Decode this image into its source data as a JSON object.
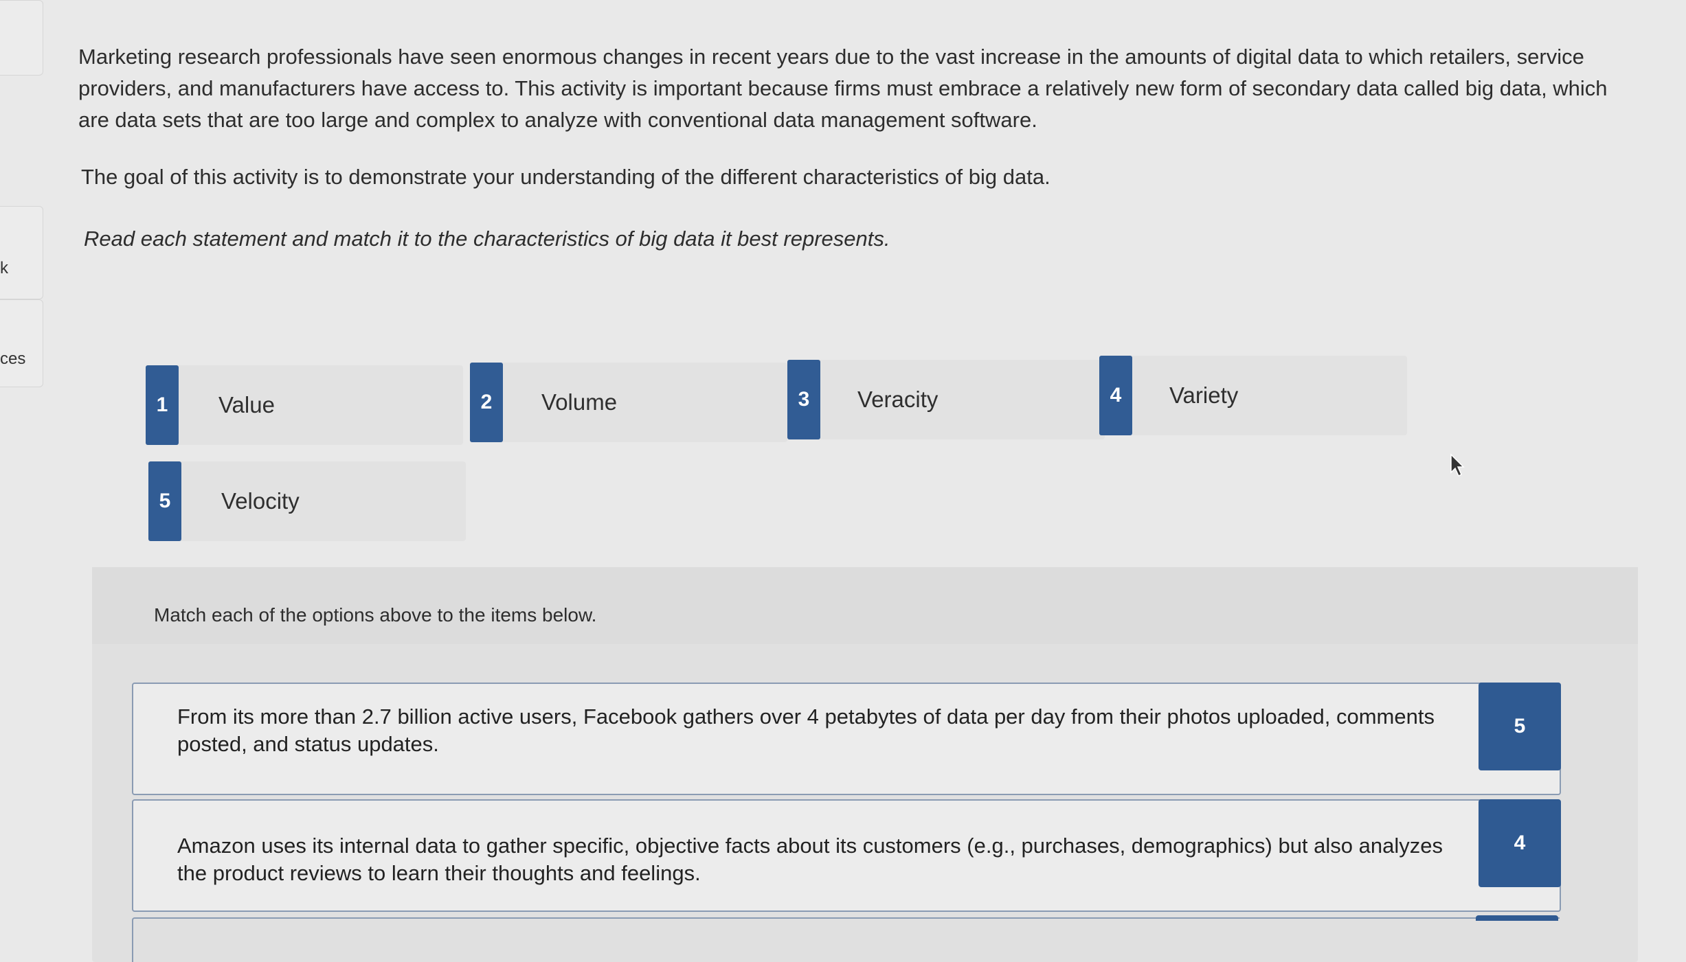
{
  "sidebar": {
    "label_k": "k",
    "label_ces": "ces"
  },
  "intro": {
    "paragraph": "Marketing research professionals have seen enormous changes in recent years due to the vast increase in the amounts of digital data to which retailers, service providers, and manufacturers have access to. This activity is important because firms must embrace a relatively new form of secondary data called big data, which are data sets that are too large and complex to analyze with conventional data management software.",
    "goal": "The goal of this activity is to demonstrate your understanding of the different characteristics of big data.",
    "direction": "Read each statement and match it to the characteristics of big data it best represents."
  },
  "options": [
    {
      "num": "1",
      "label": "Value"
    },
    {
      "num": "2",
      "label": "Volume"
    },
    {
      "num": "3",
      "label": "Veracity"
    },
    {
      "num": "4",
      "label": "Variety"
    },
    {
      "num": "5",
      "label": "Velocity"
    }
  ],
  "match": {
    "title": "Match each of the options above to the items below.",
    "items": [
      {
        "statement": "From its more than 2.7 billion active users, Facebook gathers over 4 petabytes of data per day from their photos uploaded, comments posted, and status updates.",
        "answer": "5"
      },
      {
        "statement": "Amazon uses its internal data to gather specific, objective facts about its customers (e.g., purchases, demographics) but also analyzes the product reviews to learn their thoughts and feelings.",
        "answer": "4"
      }
    ]
  },
  "colors": {
    "accent": "#315c94",
    "background": "#e9e9e9"
  },
  "icons": {
    "cursor": "mouse-pointer-icon"
  }
}
